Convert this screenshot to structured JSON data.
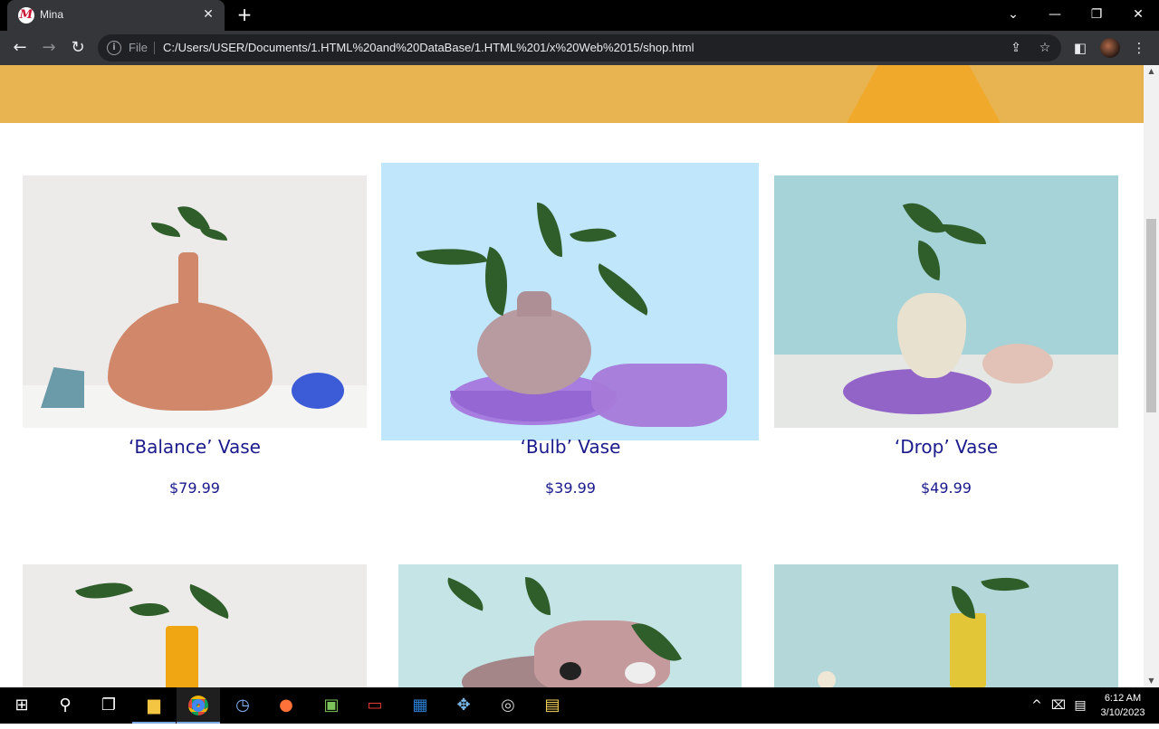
{
  "browser": {
    "tab_title": "Mina",
    "favicon_letter": "M",
    "address_scheme_label": "File",
    "url": "C:/Users/USER/Documents/1.HTML%20and%20DataBase/1.HTML%201/x%20Web%2015/shop.html"
  },
  "products": [
    {
      "name": "‘Balance’ Vase",
      "price": "$79.99",
      "bg": "#ecebea",
      "vase_color": "#d0876a"
    },
    {
      "name": "‘Bulb’ Vase",
      "price": "$39.99",
      "bg": "#bfe6fb",
      "vase_color": "#b89ba0"
    },
    {
      "name": "‘Drop’ Vase",
      "price": "$49.99",
      "bg": "#a6d3d7",
      "vase_color": "#e8e1cf"
    }
  ],
  "products_row2_colors": [
    "#ecebea",
    "#c4e4e6",
    "#b4d7d9"
  ],
  "taskbar": {
    "time": "6:12 AM",
    "date": "3/10/2023"
  },
  "colors": {
    "product_text": "#1a1a8c",
    "banner": "#e8b451"
  }
}
